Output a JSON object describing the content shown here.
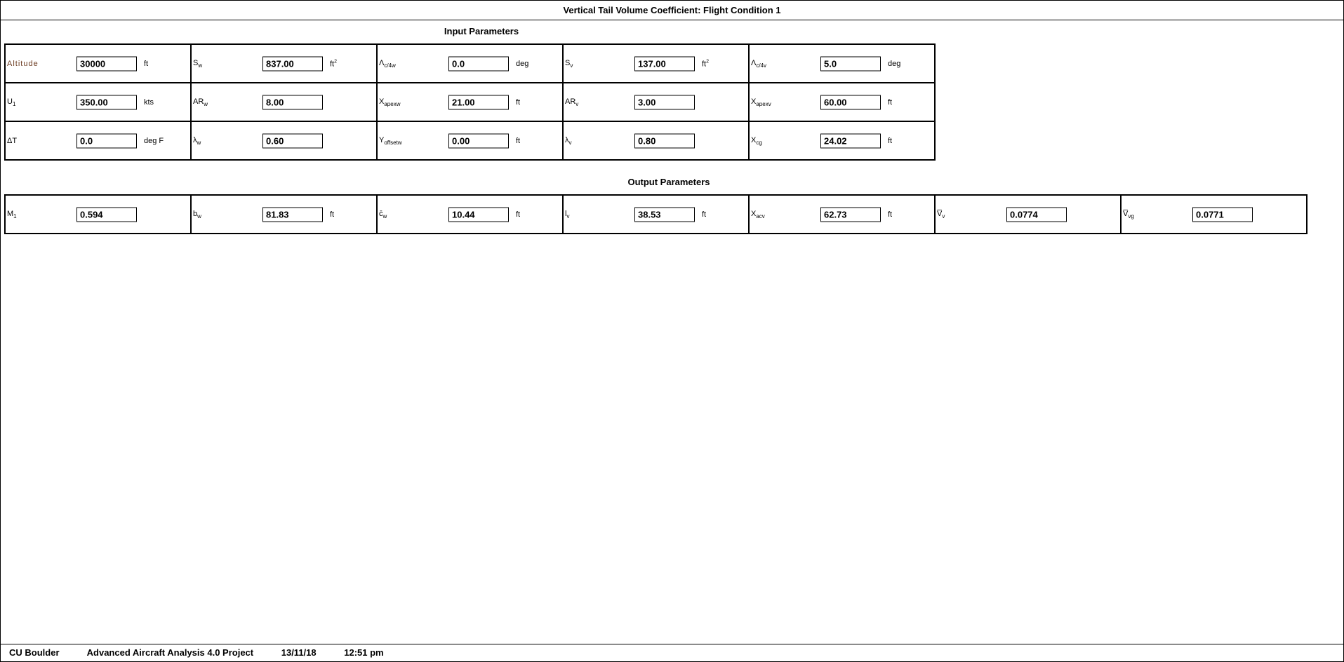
{
  "title": "Vertical Tail Volume Coefficient: Flight Condition 1",
  "input_section": {
    "title": "Input Parameters",
    "cells": [
      {
        "label": "Altitude",
        "value": "30000",
        "unit": "ft"
      },
      {
        "label": "S",
        "sub": "w",
        "value": "837.00",
        "unit": "ft",
        "sup": "2"
      },
      {
        "label": "Λ",
        "sub": "c/4w",
        "value": "0.0",
        "unit": "deg"
      },
      {
        "label": "S",
        "sub": "v",
        "value": "137.00",
        "unit": "ft",
        "sup": "2"
      },
      {
        "label": "Λ",
        "sub": "c/4v",
        "value": "5.0",
        "unit": "deg"
      },
      {
        "label": "U",
        "sub": "1",
        "value": "350.00",
        "unit": "kts"
      },
      {
        "label": "AR",
        "sub": "w",
        "value": "8.00",
        "unit": ""
      },
      {
        "label": "X",
        "sub": "apexw",
        "value": "21.00",
        "unit": "ft"
      },
      {
        "label": "AR",
        "sub": "v",
        "value": "3.00",
        "unit": ""
      },
      {
        "label": "X",
        "sub": "apexv",
        "value": "60.00",
        "unit": "ft"
      },
      {
        "label": "ΔT",
        "value": "0.0",
        "unit": "deg F"
      },
      {
        "label": "λ",
        "sub": "w",
        "value": "0.60",
        "unit": ""
      },
      {
        "label": "Y",
        "sub": "offsetw",
        "value": "0.00",
        "unit": "ft"
      },
      {
        "label": "λ",
        "sub": "v",
        "value": "0.80",
        "unit": ""
      },
      {
        "label": "X",
        "sub": "cg",
        "value": "24.02",
        "unit": "ft"
      }
    ]
  },
  "output_section": {
    "title": "Output Parameters",
    "cells": [
      {
        "label": "M",
        "sub": "1",
        "value": "0.594",
        "unit": ""
      },
      {
        "label": "b",
        "sub": "w",
        "value": "81.83",
        "unit": "ft"
      },
      {
        "label": "c̄",
        "sub": "w",
        "value": "10.44",
        "unit": "ft"
      },
      {
        "label": "l",
        "sub": "v",
        "value": "38.53",
        "unit": "ft"
      },
      {
        "label": "X",
        "sub": "acv",
        "value": "62.73",
        "unit": "ft"
      },
      {
        "label": "V̅",
        "sub": "v",
        "value": "0.0774",
        "unit": ""
      },
      {
        "label": "V̅",
        "sub": "vg",
        "value": "0.0771",
        "unit": ""
      }
    ]
  },
  "footer": {
    "org": "CU Boulder",
    "project": "Advanced Aircraft Analysis 4.0 Project",
    "date": "13/11/18",
    "time": "12:51 pm"
  }
}
